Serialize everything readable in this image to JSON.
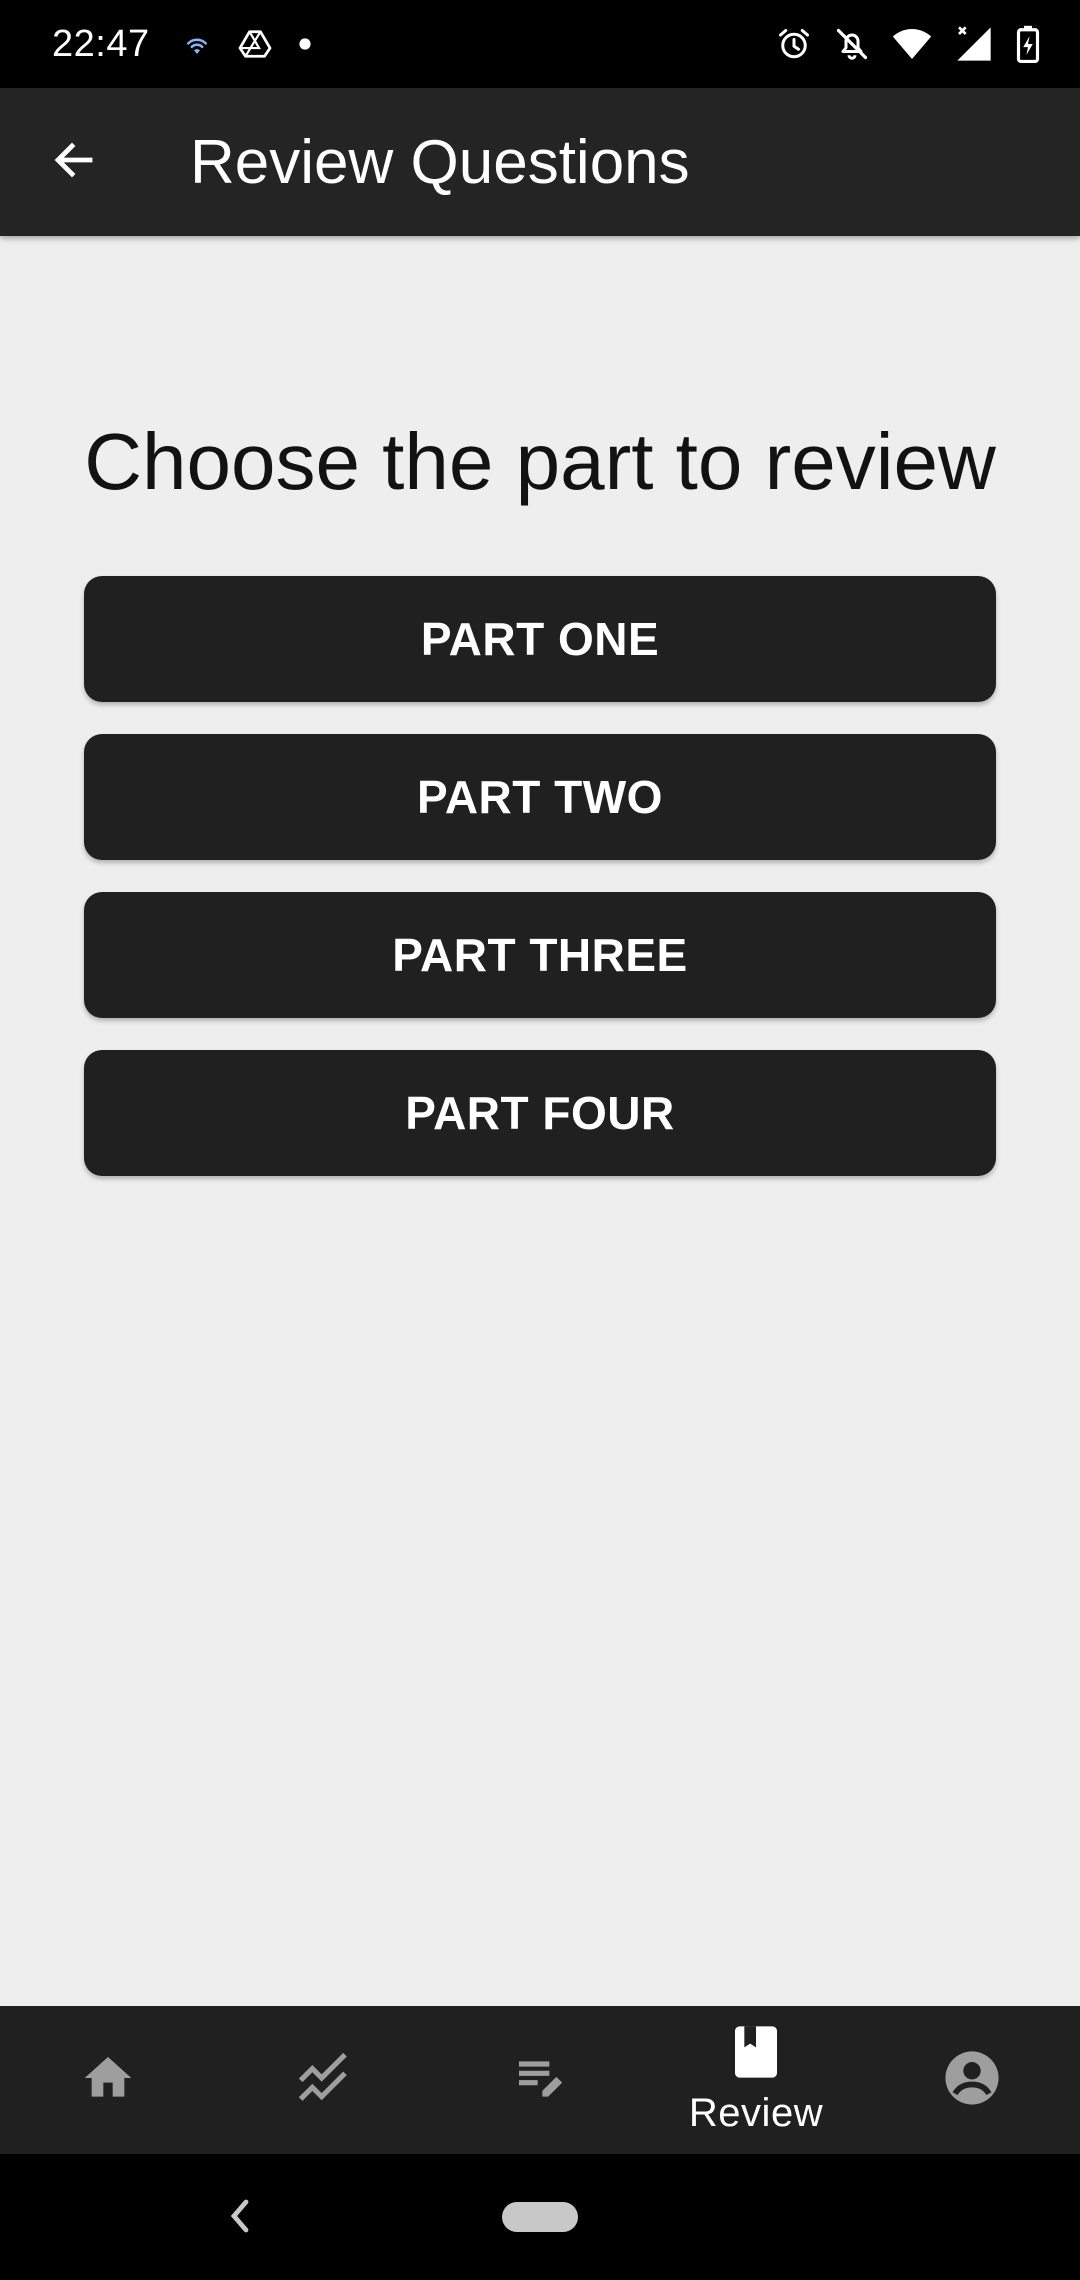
{
  "status_bar": {
    "time": "22:47",
    "left_icons": [
      "wifi-calling-icon",
      "drive-icon",
      "notification-dot-icon"
    ],
    "right_icons": [
      "alarm-icon",
      "notifications-off-icon",
      "wifi-icon",
      "signal-icon",
      "battery-charging-icon"
    ]
  },
  "app_bar": {
    "back_icon": "arrow-back-icon",
    "title": "Review Questions"
  },
  "main": {
    "prompt": "Choose the part to review",
    "parts": [
      {
        "label": "PART ONE"
      },
      {
        "label": "PART TWO"
      },
      {
        "label": "PART THREE"
      },
      {
        "label": "PART FOUR"
      }
    ]
  },
  "bottom_nav": {
    "items": [
      {
        "icon": "home-icon",
        "label": "",
        "active": false
      },
      {
        "icon": "progress-chart-icon",
        "label": "",
        "active": false
      },
      {
        "icon": "edit-list-icon",
        "label": "",
        "active": false
      },
      {
        "icon": "book-icon",
        "label": "Review",
        "active": true
      },
      {
        "icon": "account-icon",
        "label": "",
        "active": false
      }
    ]
  },
  "colors": {
    "background": "#eeeeee",
    "app_bar": "#242424",
    "button": "#202020",
    "nav_bar": "#202020",
    "nav_inactive": "#9e9e9e",
    "nav_active": "#ffffff"
  }
}
